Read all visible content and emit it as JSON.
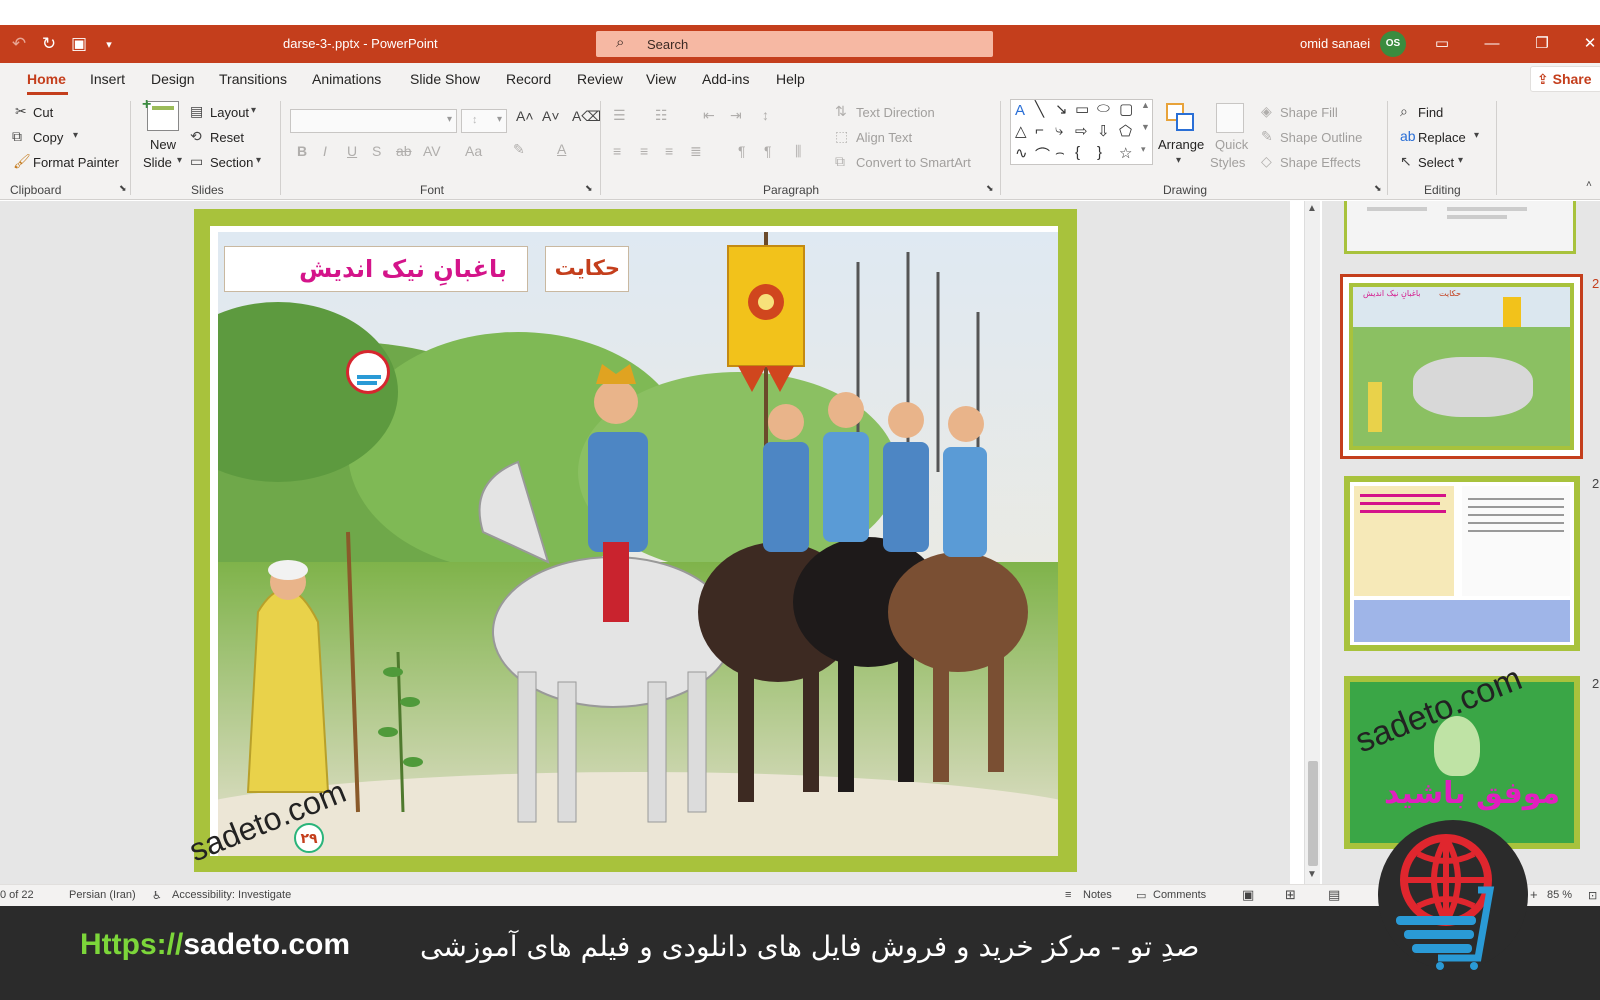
{
  "titlebar": {
    "doc_title": "darse-3-.pptx  -  PowerPoint",
    "search_placeholder": "Search",
    "user_name": "omid sanaei",
    "user_initials": "OS"
  },
  "tabs": [
    "Home",
    "Insert",
    "Design",
    "Transitions",
    "Animations",
    "Slide Show",
    "Record",
    "Review",
    "View",
    "Add-ins",
    "Help"
  ],
  "share_label": "Share",
  "ribbon": {
    "clipboard": {
      "cut": "Cut",
      "copy": "Copy",
      "format_painter": "Format Painter",
      "label": "Clipboard"
    },
    "slides": {
      "new_slide_1": "New",
      "new_slide_2": "Slide",
      "layout": "Layout",
      "reset": "Reset",
      "section": "Section",
      "label": "Slides"
    },
    "font": {
      "label": "Font"
    },
    "paragraph": {
      "text_direction": "Text Direction",
      "align_text": "Align Text",
      "convert_smartart": "Convert to SmartArt",
      "label": "Paragraph"
    },
    "drawing": {
      "arrange": "Arrange",
      "quick_1": "Quick",
      "quick_2": "Styles",
      "shape_fill": "Shape Fill",
      "shape_outline": "Shape Outline",
      "shape_effects": "Shape Effects",
      "label": "Drawing"
    },
    "editing": {
      "find": "Find",
      "replace": "Replace",
      "select": "Select",
      "label": "Editing"
    }
  },
  "slide": {
    "heading_label": "حکایت",
    "heading_title": "باغبانِ نیک اندیش",
    "page_number": "۲۹",
    "watermark": "sadeto.com"
  },
  "thumbnails": {
    "mini_title": "باغبانِ نیک اندیش",
    "mini_label": "حکایت",
    "watermark": "sadeto.com",
    "final_text": "موفق باشید",
    "numbers": [
      "2",
      "2",
      "2",
      "2"
    ]
  },
  "status": {
    "slide_count": "0 of 22",
    "language": "Persian (Iran)",
    "accessibility": "Accessibility: Investigate",
    "notes": "Notes",
    "comments": "Comments",
    "zoom": "85 %"
  },
  "banner": {
    "url_prefix": "Https://",
    "url_domain": "sadeto.com",
    "tagline": "صدِ تو - مرکز خرید و فروش فایل های دانلودی و فیلم های آموزشی"
  },
  "colors": {
    "accent": "#c43e1c",
    "slide_border": "#a8c23c",
    "banner_bg": "#2b2b2b",
    "url_green": "#7cd63a",
    "title_magenta": "#d4148a"
  }
}
